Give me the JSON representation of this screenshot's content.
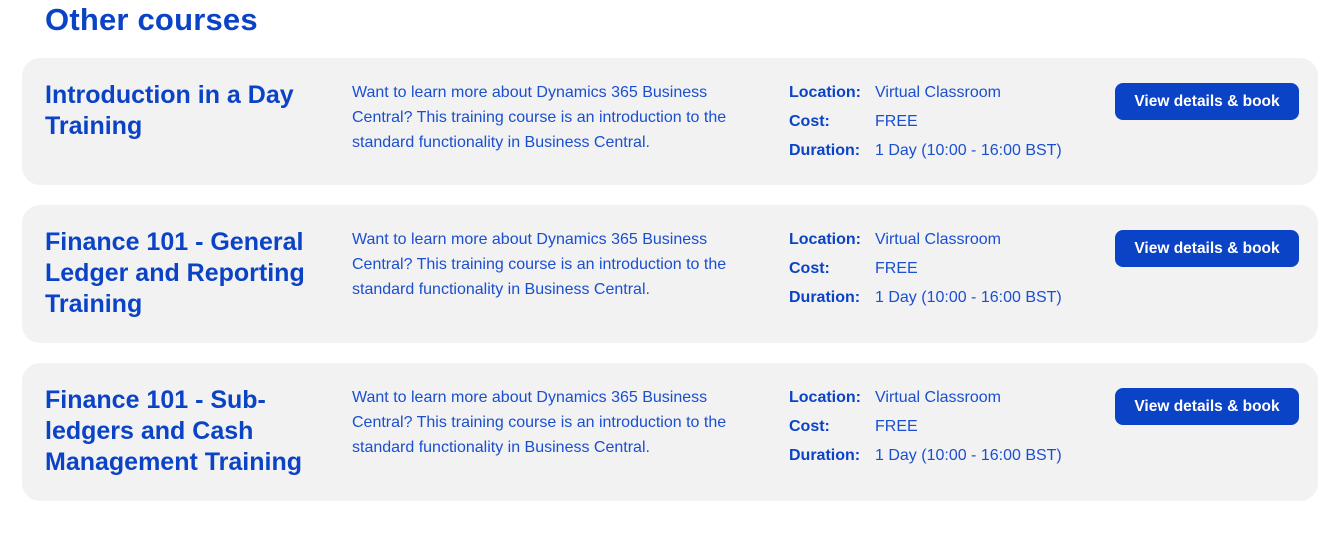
{
  "section": {
    "title": "Other courses"
  },
  "labels": {
    "location": "Location:",
    "cost": "Cost:",
    "duration": "Duration:"
  },
  "courses": [
    {
      "title": "Introduction in a Day Training",
      "description": "Want to learn more about Dynamics 365 Business Central? This training course is an introduction to the standard functionality in Business Central.",
      "location": "Virtual Classroom",
      "cost": "FREE",
      "duration": "1 Day (10:00 - 16:00 BST)",
      "button_label": "View details & book"
    },
    {
      "title": "Finance 101 - General Ledger and Reporting Training",
      "description": "Want to learn more about Dynamics 365 Business Central? This training course is an introduction to the standard functionality in Business Central.",
      "location": "Virtual Classroom",
      "cost": "FREE",
      "duration": "1 Day (10:00 - 16:00 BST)",
      "button_label": "View details & book"
    },
    {
      "title": "Finance 101 - Sub-ledgers and Cash Management Training",
      "description": "Want to learn more about Dynamics 365 Business Central? This training course is an introduction to the standard functionality in Business Central.",
      "location": "Virtual Classroom",
      "cost": "FREE",
      "duration": "1 Day (10:00 - 16:00 BST)",
      "button_label": "View details & book"
    }
  ],
  "colors": {
    "brand_blue": "#0b43c6",
    "text_blue": "#1a4fd0",
    "card_background": "#f2f2f3",
    "button_text": "#ffffff"
  }
}
